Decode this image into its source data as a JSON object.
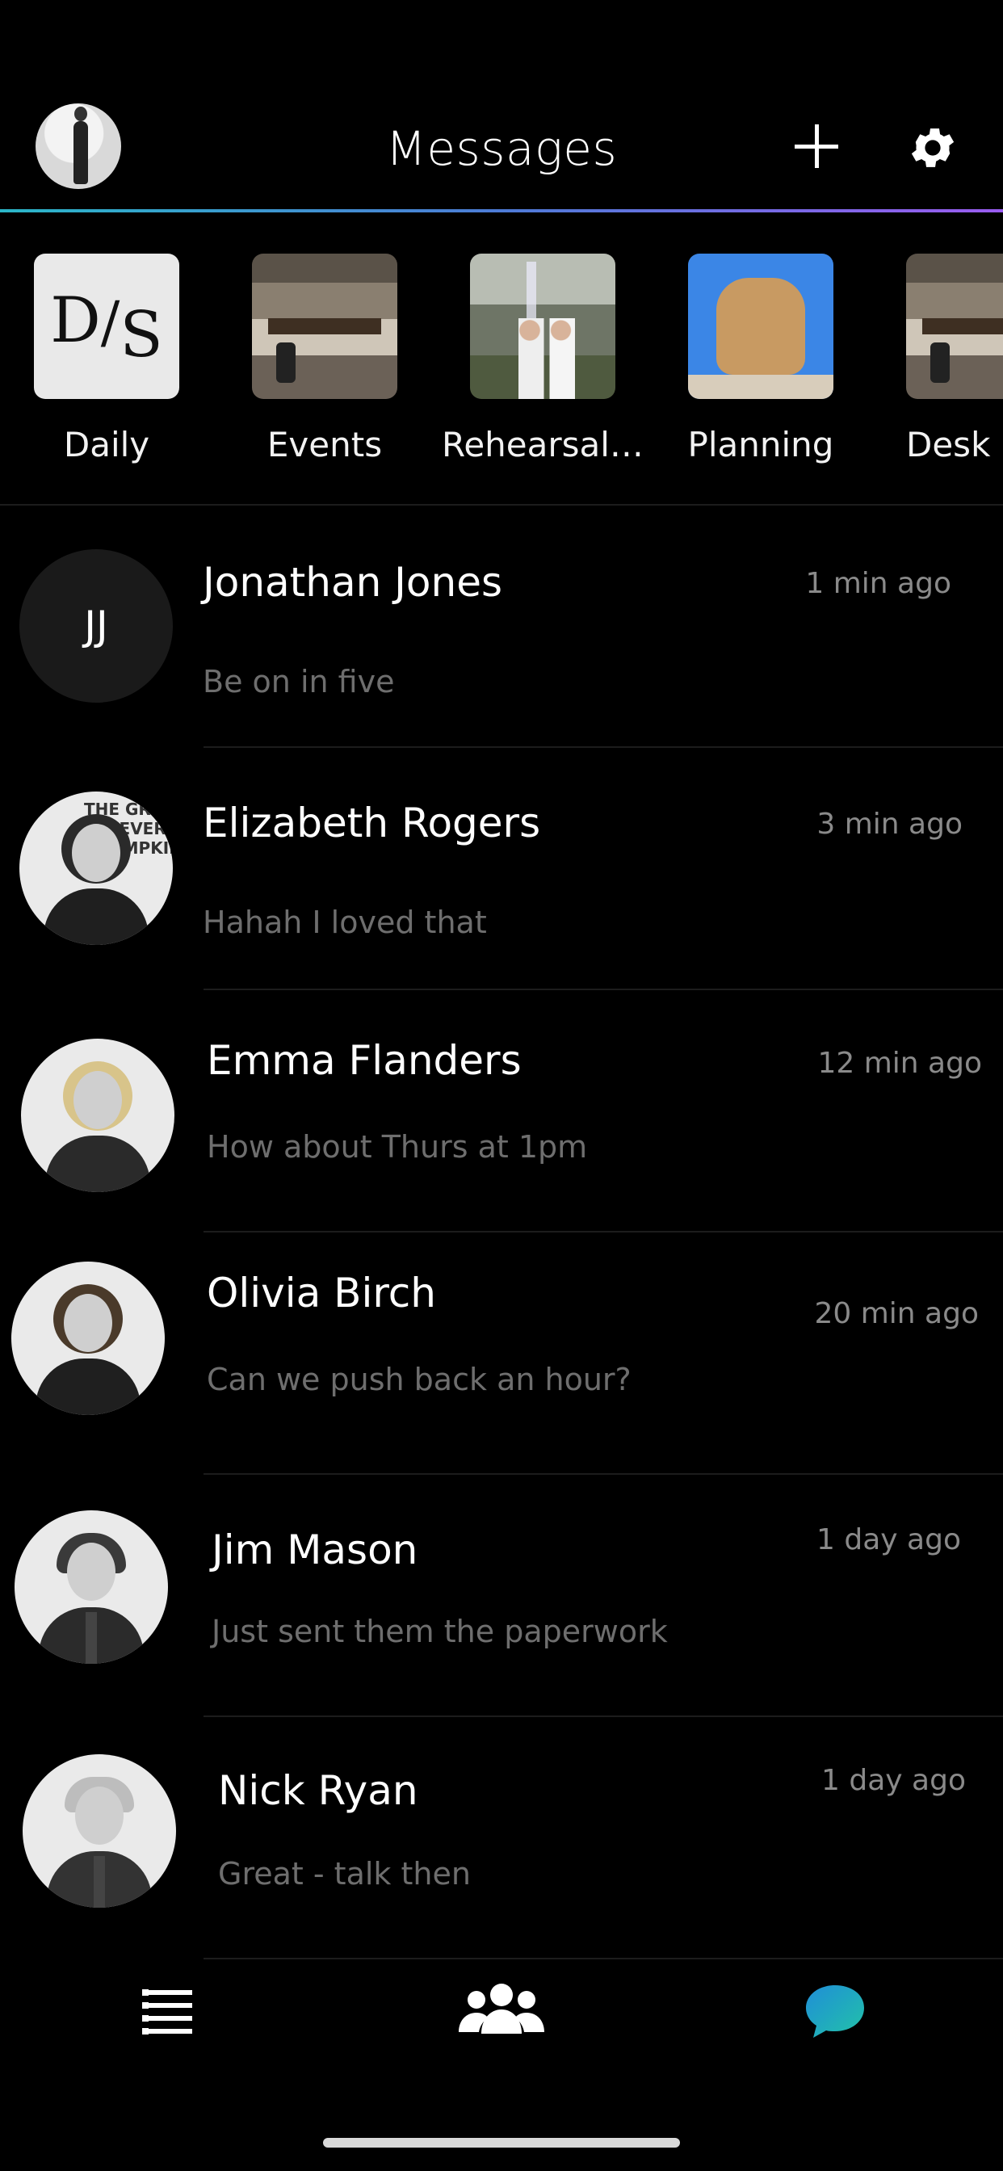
{
  "header": {
    "title": "Messages",
    "accent_line_colors": [
      "#2bb6c8",
      "#9a5cf0"
    ]
  },
  "stories": [
    {
      "label": "Daily",
      "thumb": "ds-logo",
      "logo_text": "D/S"
    },
    {
      "label": "Events",
      "thumb": "office-photo"
    },
    {
      "label": "Rehearsal…",
      "thumb": "couple-waterfall-photo"
    },
    {
      "label": "Planning",
      "thumb": "sculpture-photo"
    },
    {
      "label": "Desk",
      "thumb": "office-photo"
    }
  ],
  "messages": [
    {
      "name": "Jonathan Jones",
      "time": "1 min ago",
      "preview": "Be on in five",
      "avatar": "initials",
      "initials": "JJ"
    },
    {
      "name": "Elizabeth Rogers",
      "time": "3 min ago",
      "preview": "Hahah I loved that",
      "avatar": "photo",
      "sign_text": "THE GRE\nIVE EVER\n#PUMPKINS"
    },
    {
      "name": "Emma Flanders",
      "time": "12 min ago",
      "preview": "How about Thurs at 1pm",
      "avatar": "photo"
    },
    {
      "name": "Olivia Birch",
      "time": "20 min ago",
      "preview": "Can we push back an hour?",
      "avatar": "photo"
    },
    {
      "name": "Jim Mason",
      "time": "1 day ago",
      "preview": "Just sent them the paperwork",
      "avatar": "photo"
    },
    {
      "name": "Nick Ryan",
      "time": "1 day ago",
      "preview": "Great - talk then",
      "avatar": "photo"
    }
  ],
  "tabbar": {
    "items": [
      {
        "icon": "list-icon",
        "active": false
      },
      {
        "icon": "people-icon",
        "active": false
      },
      {
        "icon": "chat-bubble-icon",
        "active": true
      }
    ],
    "active_color": "#1fa9c8"
  }
}
